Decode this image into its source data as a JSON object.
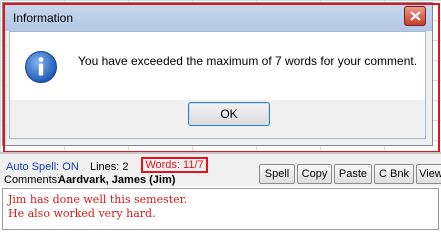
{
  "dialog": {
    "title": "Information",
    "message": "You have exceeded the maximum of 7 words for your comment.",
    "ok_label": "OK"
  },
  "toolbar": {
    "auto_spell": "Auto Spell: ON",
    "lines": "Lines: 2",
    "words": "Words: 11/7",
    "comments_label": "Comments:",
    "student_name": "Aardvark, James (Jim)",
    "buttons": [
      "Spell",
      "Copy",
      "Paste",
      "C Bnk",
      "View"
    ]
  },
  "comment": {
    "lines": [
      "Jim has done well this semester.",
      "He also worked very hard."
    ]
  },
  "colors": {
    "highlight": "#e0141e",
    "comment_text": "#d11b1b",
    "auto_spell": "#1a3fb0"
  },
  "icons": {
    "info": "info-icon",
    "close": "close-icon"
  }
}
